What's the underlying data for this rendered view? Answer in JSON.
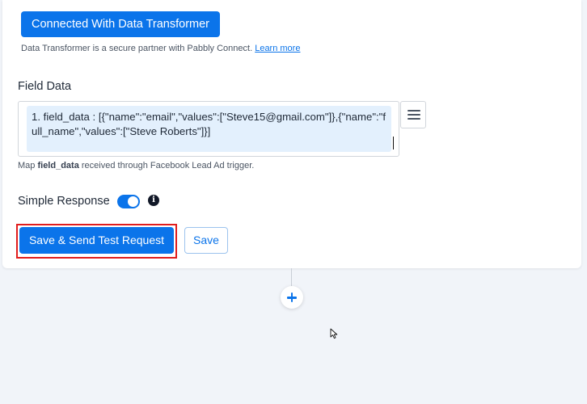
{
  "transformer": {
    "button_label": "Connected With Data Transformer",
    "note": "Data Transformer is a secure partner with Pabbly Connect.",
    "learn_more": "Learn more"
  },
  "field_data": {
    "label": "Field Data",
    "value": "1. field_data : [{\"name\":\"email\",\"values\":[\"Steve15@gmail.com\"]},{\"name\":\"full_name\",\"values\":[\"Steve Roberts\"]}]",
    "hint_prefix": "Map ",
    "hint_field": "field_data",
    "hint_suffix": " received through Facebook Lead Ad trigger."
  },
  "simple_response": {
    "label": "Simple Response",
    "enabled": true
  },
  "actions": {
    "send_test_label": "Save & Send Test Request",
    "save_label": "Save"
  },
  "colors": {
    "accent": "#0b74ea",
    "highlight": "#e11d1d",
    "background": "#f1f4f9"
  }
}
